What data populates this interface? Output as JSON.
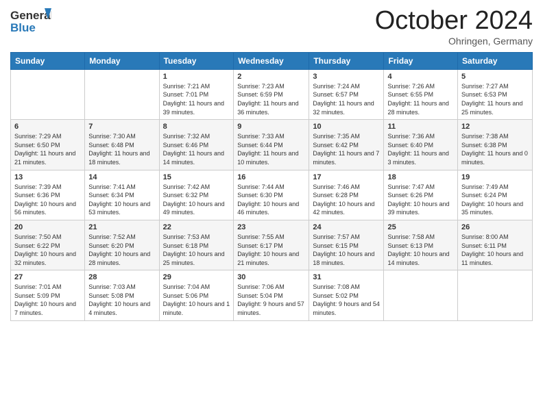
{
  "header": {
    "logo_general": "General",
    "logo_blue": "Blue",
    "month_title": "October 2024",
    "subtitle": "Ohringen, Germany"
  },
  "days_of_week": [
    "Sunday",
    "Monday",
    "Tuesday",
    "Wednesday",
    "Thursday",
    "Friday",
    "Saturday"
  ],
  "weeks": [
    [
      {
        "day": "",
        "info": ""
      },
      {
        "day": "",
        "info": ""
      },
      {
        "day": "1",
        "info": "Sunrise: 7:21 AM\nSunset: 7:01 PM\nDaylight: 11 hours and 39 minutes."
      },
      {
        "day": "2",
        "info": "Sunrise: 7:23 AM\nSunset: 6:59 PM\nDaylight: 11 hours and 36 minutes."
      },
      {
        "day": "3",
        "info": "Sunrise: 7:24 AM\nSunset: 6:57 PM\nDaylight: 11 hours and 32 minutes."
      },
      {
        "day": "4",
        "info": "Sunrise: 7:26 AM\nSunset: 6:55 PM\nDaylight: 11 hours and 28 minutes."
      },
      {
        "day": "5",
        "info": "Sunrise: 7:27 AM\nSunset: 6:53 PM\nDaylight: 11 hours and 25 minutes."
      }
    ],
    [
      {
        "day": "6",
        "info": "Sunrise: 7:29 AM\nSunset: 6:50 PM\nDaylight: 11 hours and 21 minutes."
      },
      {
        "day": "7",
        "info": "Sunrise: 7:30 AM\nSunset: 6:48 PM\nDaylight: 11 hours and 18 minutes."
      },
      {
        "day": "8",
        "info": "Sunrise: 7:32 AM\nSunset: 6:46 PM\nDaylight: 11 hours and 14 minutes."
      },
      {
        "day": "9",
        "info": "Sunrise: 7:33 AM\nSunset: 6:44 PM\nDaylight: 11 hours and 10 minutes."
      },
      {
        "day": "10",
        "info": "Sunrise: 7:35 AM\nSunset: 6:42 PM\nDaylight: 11 hours and 7 minutes."
      },
      {
        "day": "11",
        "info": "Sunrise: 7:36 AM\nSunset: 6:40 PM\nDaylight: 11 hours and 3 minutes."
      },
      {
        "day": "12",
        "info": "Sunrise: 7:38 AM\nSunset: 6:38 PM\nDaylight: 11 hours and 0 minutes."
      }
    ],
    [
      {
        "day": "13",
        "info": "Sunrise: 7:39 AM\nSunset: 6:36 PM\nDaylight: 10 hours and 56 minutes."
      },
      {
        "day": "14",
        "info": "Sunrise: 7:41 AM\nSunset: 6:34 PM\nDaylight: 10 hours and 53 minutes."
      },
      {
        "day": "15",
        "info": "Sunrise: 7:42 AM\nSunset: 6:32 PM\nDaylight: 10 hours and 49 minutes."
      },
      {
        "day": "16",
        "info": "Sunrise: 7:44 AM\nSunset: 6:30 PM\nDaylight: 10 hours and 46 minutes."
      },
      {
        "day": "17",
        "info": "Sunrise: 7:46 AM\nSunset: 6:28 PM\nDaylight: 10 hours and 42 minutes."
      },
      {
        "day": "18",
        "info": "Sunrise: 7:47 AM\nSunset: 6:26 PM\nDaylight: 10 hours and 39 minutes."
      },
      {
        "day": "19",
        "info": "Sunrise: 7:49 AM\nSunset: 6:24 PM\nDaylight: 10 hours and 35 minutes."
      }
    ],
    [
      {
        "day": "20",
        "info": "Sunrise: 7:50 AM\nSunset: 6:22 PM\nDaylight: 10 hours and 32 minutes."
      },
      {
        "day": "21",
        "info": "Sunrise: 7:52 AM\nSunset: 6:20 PM\nDaylight: 10 hours and 28 minutes."
      },
      {
        "day": "22",
        "info": "Sunrise: 7:53 AM\nSunset: 6:18 PM\nDaylight: 10 hours and 25 minutes."
      },
      {
        "day": "23",
        "info": "Sunrise: 7:55 AM\nSunset: 6:17 PM\nDaylight: 10 hours and 21 minutes."
      },
      {
        "day": "24",
        "info": "Sunrise: 7:57 AM\nSunset: 6:15 PM\nDaylight: 10 hours and 18 minutes."
      },
      {
        "day": "25",
        "info": "Sunrise: 7:58 AM\nSunset: 6:13 PM\nDaylight: 10 hours and 14 minutes."
      },
      {
        "day": "26",
        "info": "Sunrise: 8:00 AM\nSunset: 6:11 PM\nDaylight: 10 hours and 11 minutes."
      }
    ],
    [
      {
        "day": "27",
        "info": "Sunrise: 7:01 AM\nSunset: 5:09 PM\nDaylight: 10 hours and 7 minutes."
      },
      {
        "day": "28",
        "info": "Sunrise: 7:03 AM\nSunset: 5:08 PM\nDaylight: 10 hours and 4 minutes."
      },
      {
        "day": "29",
        "info": "Sunrise: 7:04 AM\nSunset: 5:06 PM\nDaylight: 10 hours and 1 minute."
      },
      {
        "day": "30",
        "info": "Sunrise: 7:06 AM\nSunset: 5:04 PM\nDaylight: 9 hours and 57 minutes."
      },
      {
        "day": "31",
        "info": "Sunrise: 7:08 AM\nSunset: 5:02 PM\nDaylight: 9 hours and 54 minutes."
      },
      {
        "day": "",
        "info": ""
      },
      {
        "day": "",
        "info": ""
      }
    ]
  ]
}
